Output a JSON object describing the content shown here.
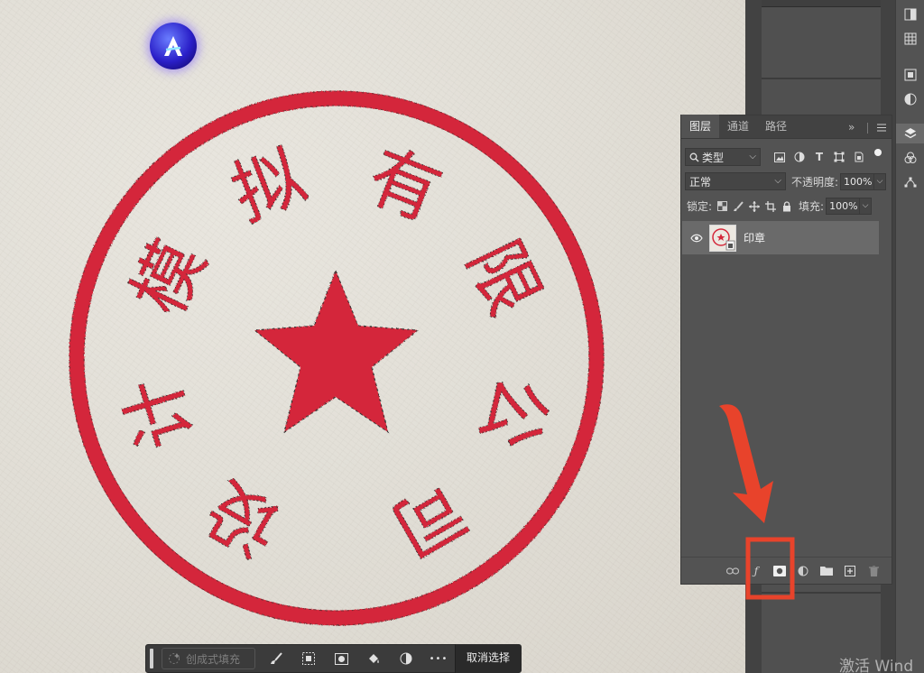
{
  "canvas": {
    "seal_text": [
      "设",
      "计",
      "模",
      "拟",
      "有",
      "限",
      "公",
      "司"
    ],
    "seal_color": "#d4283a",
    "paper_color": "#e4e1da"
  },
  "layers_panel": {
    "tabs": [
      {
        "label": "图层",
        "active": true
      },
      {
        "label": "通道",
        "active": false
      },
      {
        "label": "路径",
        "active": false
      }
    ],
    "menu_glyph": "»",
    "filter": {
      "search_glyph": "🔍",
      "kind_label": "类型"
    },
    "blend_mode": "正常",
    "opacity_label": "不透明度:",
    "opacity_value": "100%",
    "lock_label": "锁定:",
    "fill_label": "填充:",
    "fill_value": "100%",
    "layers": [
      {
        "name": "印章",
        "visible": true,
        "selected": true
      }
    ]
  },
  "task_bar": {
    "generative_fill": "创成式填充",
    "more_glyph": "•••",
    "deselect": "取消选择"
  },
  "annotation": {
    "color": "#e8432b"
  },
  "watermark": "激活 Wind"
}
